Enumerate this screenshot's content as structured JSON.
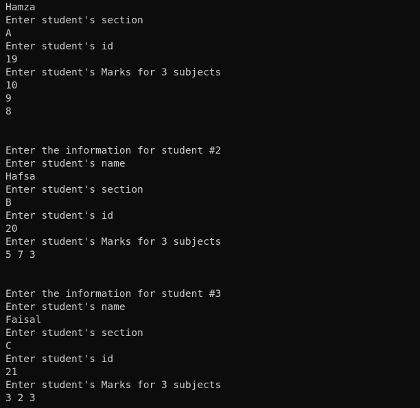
{
  "terminal": {
    "lines": [
      "Hamza",
      "Enter student's section",
      "A",
      "Enter student's id",
      "19",
      "Enter student's Marks for 3 subjects",
      "10",
      "9",
      "8",
      "",
      "",
      "Enter the information for student #2",
      "Enter student's name",
      "Hafsa",
      "Enter student's section",
      "B",
      "Enter student's id",
      "20",
      "Enter student's Marks for 3 subjects",
      "5 7 3",
      "",
      "",
      "Enter the information for student #3",
      "Enter student's name",
      "Faisal",
      "Enter student's section",
      "C",
      "Enter student's id",
      "21",
      "Enter student's Marks for 3 subjects",
      "3 2 3",
      ""
    ]
  }
}
